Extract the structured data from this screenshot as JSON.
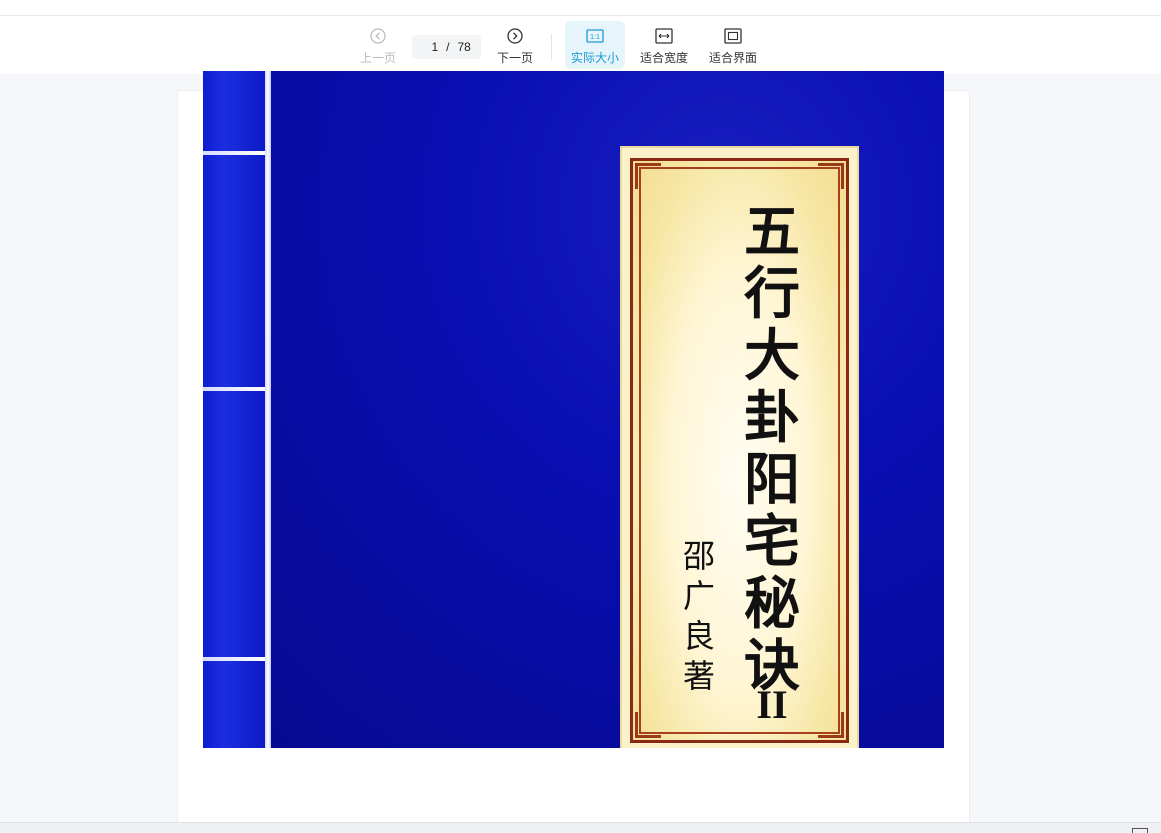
{
  "toolbar": {
    "prev_label": "上一页",
    "next_label": "下一页",
    "current_page": "1",
    "separator": "/",
    "total_pages": "78",
    "actual_size_label": "实际大小",
    "actual_size_icon_text": "1:1",
    "fit_width_label": "适合宽度",
    "fit_page_label": "适合界面"
  },
  "document": {
    "cover_title": "五行大卦阳宅秘诀",
    "cover_author": "邵广良著",
    "cover_volume": "II"
  },
  "colors": {
    "accent": "#1a9ad6",
    "cover_blue": "#0a0fb3",
    "label_border": "#8a2a14"
  }
}
